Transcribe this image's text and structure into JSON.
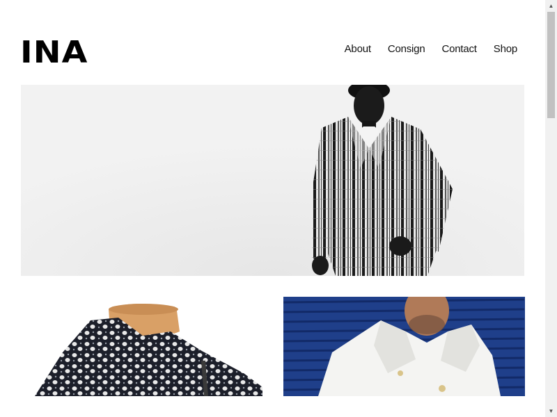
{
  "brand": {
    "logo": "INA"
  },
  "nav": {
    "items": [
      {
        "label": "About"
      },
      {
        "label": "Consign"
      },
      {
        "label": "Contact"
      },
      {
        "label": "Shop"
      }
    ]
  },
  "hero": {
    "image_subject": "model in black-and-white striped jacket"
  },
  "tiles": [
    {
      "image_subject": "black-and-white patterned knit jacket on wooden mannequin"
    },
    {
      "image_subject": "man in white double-breasted coat against blue shutter"
    }
  ],
  "colors": {
    "text": "#111111",
    "hero_bg": "#f1f1f1",
    "shutter_blue": "#1f3f8a"
  },
  "icons": {
    "scroll_up": "triangle-up",
    "scroll_down": "triangle-down"
  }
}
